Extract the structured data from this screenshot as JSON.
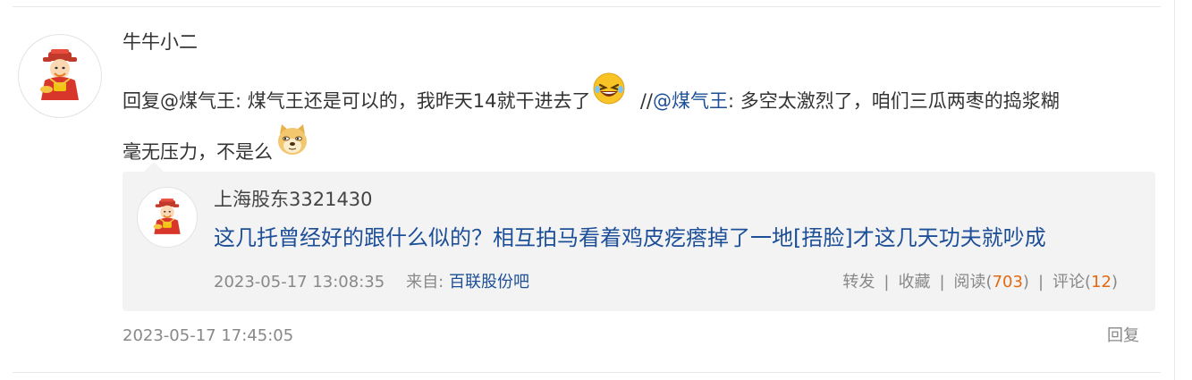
{
  "post": {
    "username": "牛牛小二",
    "text_part1": "回复@煤气王: 煤气王还是可以的，我昨天14就干进去了",
    "emoji1": "laughing-emoji",
    "separator": "//",
    "mention": "@煤气王",
    "text_part2": ": 多空太激烈了，咱们三瓜两枣的捣浆糊",
    "text_part3": "毫无压力，不是么",
    "emoji2": "doge-emoji",
    "timestamp": "2023-05-17 17:45:05",
    "reply_label": "回复"
  },
  "quote": {
    "username": "上海股东3321430",
    "text": "这几托曾经好的跟什么似的？相互拍马看着鸡皮疙瘩掉了一地[捂脸]才这几天功夫就吵成",
    "timestamp": "2023-05-17 13:08:35",
    "source_label": "来自:",
    "source_name": "百联股份吧",
    "actions": {
      "forward": "转发",
      "favorite": "收藏",
      "read_label": "阅读(",
      "read_count": "703",
      "comment_label": "评论(",
      "comment_count": "12",
      "close_paren": ")",
      "separator": "|"
    }
  },
  "colors": {
    "link_blue": "#1d4f98",
    "count_orange": "#e46a12",
    "quote_bg": "#f3f3f3",
    "meta_gray": "#888888"
  }
}
